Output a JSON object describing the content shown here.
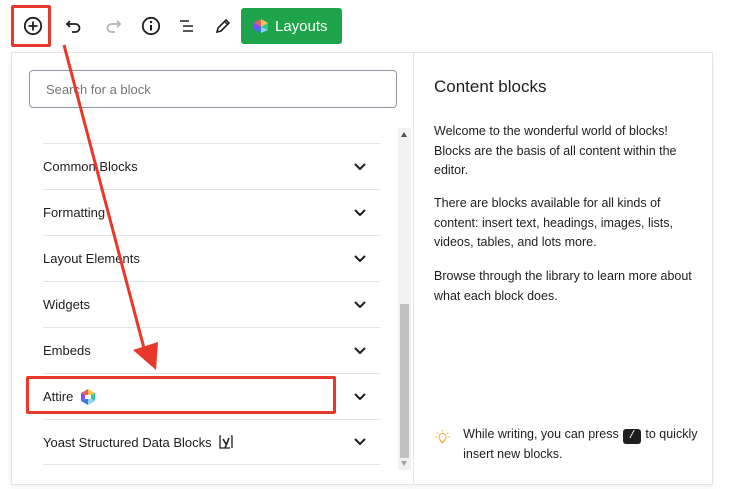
{
  "toolbar": {
    "add_block_icon": "plus-circle-icon",
    "undo_icon": "undo-icon",
    "redo_icon": "redo-icon",
    "info_icon": "info-icon",
    "outline_icon": "list-view-icon",
    "edit_icon": "pencil-icon",
    "layouts_label": "Layouts",
    "layouts_icon": "layouts-logo-icon",
    "layouts_color": "#1ea54b"
  },
  "inserter": {
    "search_placeholder": "Search for a block",
    "categories": [
      {
        "label": "Common Blocks",
        "icon": "chevron-down-icon"
      },
      {
        "label": "Formatting",
        "icon": "chevron-down-icon"
      },
      {
        "label": "Layout Elements",
        "icon": "chevron-down-icon"
      },
      {
        "label": "Widgets",
        "icon": "chevron-down-icon"
      },
      {
        "label": "Embeds",
        "icon": "chevron-down-icon"
      },
      {
        "label": "Attire",
        "icon": "chevron-down-icon",
        "badge_icon": "attire-logo-icon"
      },
      {
        "label": "Yoast Structured Data Blocks",
        "icon": "chevron-down-icon",
        "badge_icon": "yoast-logo-icon"
      }
    ]
  },
  "help": {
    "title": "Content blocks",
    "para1": "Welcome to the wonderful world of blocks! Blocks are the basis of all content within the editor.",
    "para2": "There are blocks available for all kinds of content: insert text, headings, images, lists, videos, tables, and lots more.",
    "para3": "Browse through the library to learn more about what each block does.",
    "tip_before": "While writing, you can press",
    "tip_key": "/",
    "tip_after": "to quickly insert new blocks.",
    "tip_icon": "lightbulb-icon"
  },
  "annotation_color": "#e8382c"
}
